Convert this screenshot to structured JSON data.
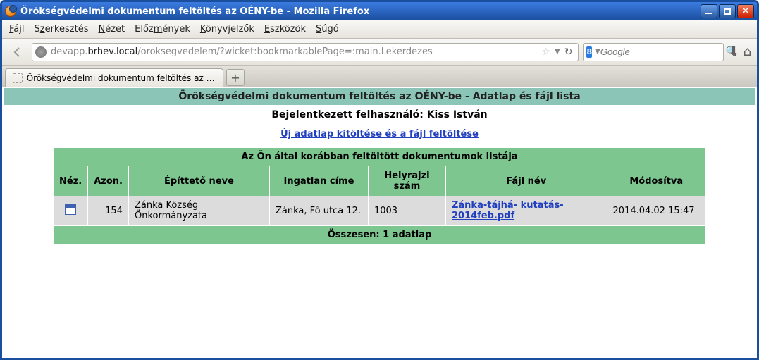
{
  "window": {
    "title": "Örökségvédelmi dokumentum feltöltés az OÉNY-be - Mozilla Firefox"
  },
  "menu": {
    "file": "Fájl",
    "edit": "Szerkesztés",
    "view": "Nézet",
    "history": "Előzmények",
    "bookmarks": "Könyvjelzők",
    "tools": "Eszközök",
    "help": "Súgó"
  },
  "address": {
    "prefix": "devapp.",
    "host": "brhev.local",
    "path": "/oroksegvedelem/?wicket:bookmarkablePage=:main.Lekerdezes"
  },
  "search": {
    "engine_glyph": "8",
    "placeholder": "Google"
  },
  "tab": {
    "label": "Örökségvédelmi dokumentum feltöltés az O..."
  },
  "page": {
    "header": "Örökségvédelmi dokumentum feltöltés az OÉNY-be - Adatlap és fájl lista",
    "user_label": "Bejelentkezett felhasználó: ",
    "user_name": "Kiss István",
    "new_link": "Új adatlap kitöltése és a fájl feltöltése"
  },
  "table": {
    "title": "Az Ön által korábban feltöltött dokumentumok listája",
    "headers": {
      "view": "Néz.",
      "id": "Azon.",
      "builder": "Építtető neve",
      "address": "Ingatlan címe",
      "parcel": "Helyrajzi szám",
      "file": "Fájl név",
      "modified": "Módosítva"
    },
    "rows": [
      {
        "id": "154",
        "builder": "Zánka Község Önkormányzata",
        "address": "Zánka, Fő utca 12.",
        "parcel": "1003",
        "file": "Zánka-tájhá- kutatás-2014feb.pdf",
        "modified": "2014.04.02 15:47"
      }
    ],
    "footer": "Összesen: 1 adatlap"
  }
}
